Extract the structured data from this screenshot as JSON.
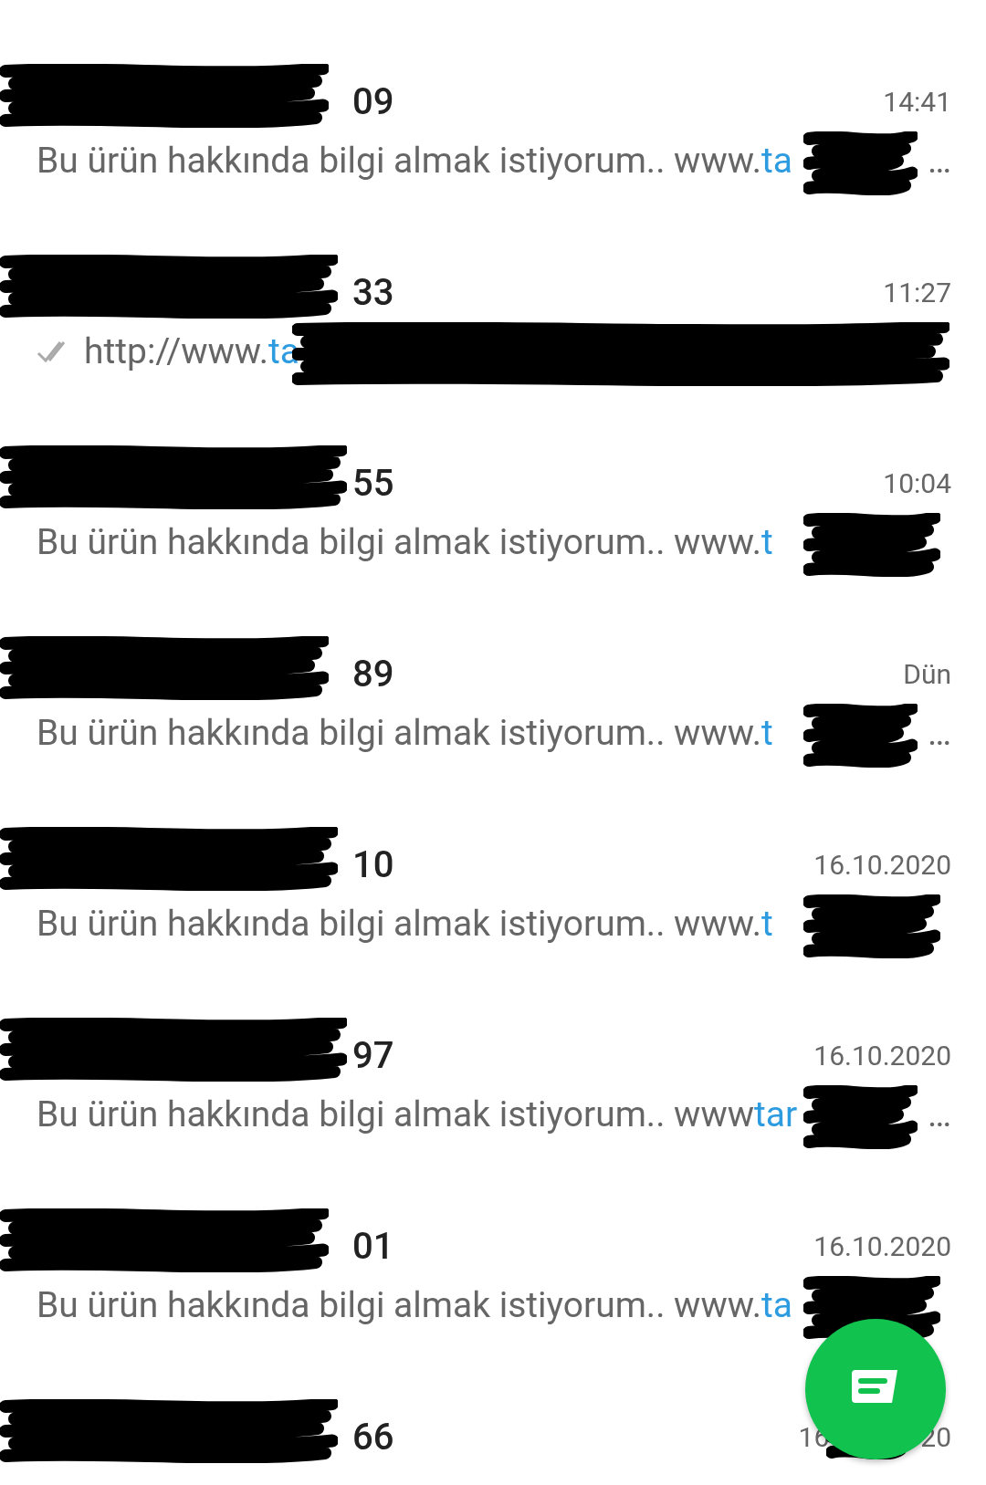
{
  "chats": [
    {
      "kind": "received",
      "name": "09",
      "time": "14:41",
      "preview": {
        "text": "Bu ürün hakkında bilgi almak istiyorum.. www.",
        "link": "ta",
        "tail": "…"
      }
    },
    {
      "kind": "sent",
      "name": "33",
      "time": "11:27",
      "preview": {
        "text": "http://www.",
        "link": "ta"
      }
    },
    {
      "kind": "received",
      "name": "55",
      "time": "10:04",
      "preview": {
        "text": "Bu ürün hakkında bilgi almak istiyorum.. www.",
        "link": "t"
      }
    },
    {
      "kind": "received",
      "name": "89",
      "time": "Dün",
      "preview": {
        "text": "Bu ürün hakkında bilgi almak istiyorum.. www.",
        "link": "t",
        "tail": "…"
      }
    },
    {
      "kind": "received",
      "name": "10",
      "time": "16.10.2020",
      "preview": {
        "text": "Bu ürün hakkında bilgi almak istiyorum.. www.",
        "link": "t"
      }
    },
    {
      "kind": "received",
      "name": "97",
      "time": "16.10.2020",
      "preview": {
        "text": "Bu ürün hakkında bilgi almak istiyorum.. www",
        "link": "tar",
        "tail": "…"
      }
    },
    {
      "kind": "received",
      "name": "01",
      "time": "16.10.2020",
      "preview": {
        "text": "Bu ürün hakkında bilgi almak istiyorum.. www.",
        "link": "ta"
      }
    },
    {
      "kind": "received",
      "name": "66",
      "time": "16",
      "time_end": "20"
    }
  ]
}
